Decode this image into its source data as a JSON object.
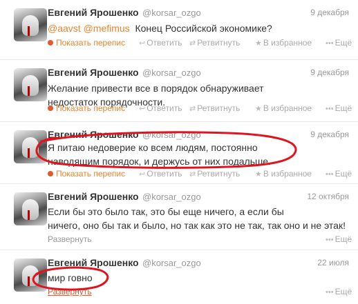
{
  "tweets": [
    {
      "name": "Евгений Ярошенко",
      "handle": "@korsar_ozgo",
      "date": "9 декабря",
      "mentions": [
        "@aavst",
        "@mefimus"
      ],
      "text": "Конец Российской экономике?",
      "conversation_label": "Показать перепис",
      "reply_label": "Ответить",
      "retweet_label": "Ретвитнуть",
      "fav_label": "В избранное",
      "more_label": "Ещё"
    },
    {
      "name": "Евгений Ярошенко",
      "handle": "@korsar_ozgo",
      "date": "9 декабря",
      "text_line1": "Желание привести все в порядок обнаруживает",
      "text_line2": "недостаток порядочности.",
      "conversation_label": "Показать перепис",
      "reply_label": "Ответить",
      "retweet_label": "Ретвитнуть",
      "fav_label": "В избранное",
      "more_label": "Ещё"
    },
    {
      "name": "Евгений Ярошенко",
      "handle": "@korsar_ozgo",
      "date": "9 декабря",
      "text_line1": "Я питаю недоверие ко всем людям, постоянно",
      "text_line2": "наводящим порядок, и держусь от них подальше.",
      "conversation_label": "Показать перепис",
      "reply_label": "Ответить",
      "retweet_label": "Ретвитнуть",
      "fav_label": "В избранное",
      "more_label": "Ещё"
    },
    {
      "name": "Евгений Ярошенко",
      "handle": "@korsar_ozgo",
      "date": "12 октября",
      "text_line1": "Если бы это было так, это бы еще ничего, а если бы",
      "text_line2": "ничего, оно бы так и было, но так как это не так, так оно и не этак!",
      "expand_label": "Развернуть",
      "more_label": "Ещё"
    },
    {
      "name": "Евгений Ярошенко",
      "handle": "@korsar_ozgo",
      "date": "22 июля",
      "text": "мир говно",
      "expand_label": "Развернуть",
      "more_label": "Ещё"
    }
  ],
  "icons": {
    "reply": "reply-arrow-icon",
    "retweet": "retweet-icon",
    "favorite": "star-icon",
    "more": "dots-icon",
    "conversation": "conversation-bubble-icon"
  },
  "colors": {
    "accent": "#e8832e",
    "scribble": "#e0141e",
    "muted": "#999999"
  }
}
